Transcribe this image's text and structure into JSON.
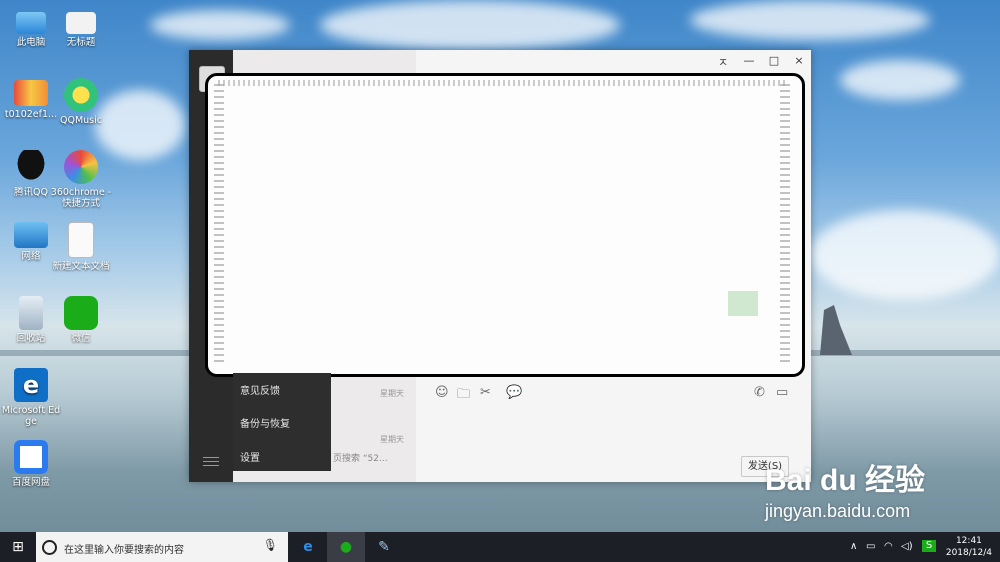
{
  "desktop": {
    "icons": [
      {
        "label": "此电脑"
      },
      {
        "label": "无标题"
      },
      {
        "label": "t0102ef1..."
      },
      {
        "label": "QQMusic"
      },
      {
        "label": "腾讯QQ"
      },
      {
        "label": "360chrome - 快捷方式"
      },
      {
        "label": "网络"
      },
      {
        "label": "新建文本文档"
      },
      {
        "label": "回收站"
      },
      {
        "label": "微信"
      },
      {
        "label": "Microsoft Edge"
      },
      {
        "label": "百度网盘"
      }
    ]
  },
  "wechat": {
    "window_controls": {
      "pin": "ㅈ",
      "minimize": "—",
      "maximize": "□",
      "close": "×"
    },
    "list_times": [
      "星期天",
      "星期天"
    ],
    "list_snippet": "页搜索 “52...",
    "menu": {
      "feedback": "意见反馈",
      "backup": "备份与恢复",
      "settings": "设置"
    },
    "send_label": "发送(S)"
  },
  "taskbar": {
    "search_placeholder": "在这里输入你要搜索的内容",
    "time": "12:41",
    "date": "2018/12/4"
  },
  "watermark": {
    "logo": "Bai du 经验",
    "url": "jingyan.baidu.com"
  },
  "colors": {
    "accent": "#1aad19",
    "edge_blue": "#0f6fc6",
    "taskbar": "#1d1f26"
  }
}
